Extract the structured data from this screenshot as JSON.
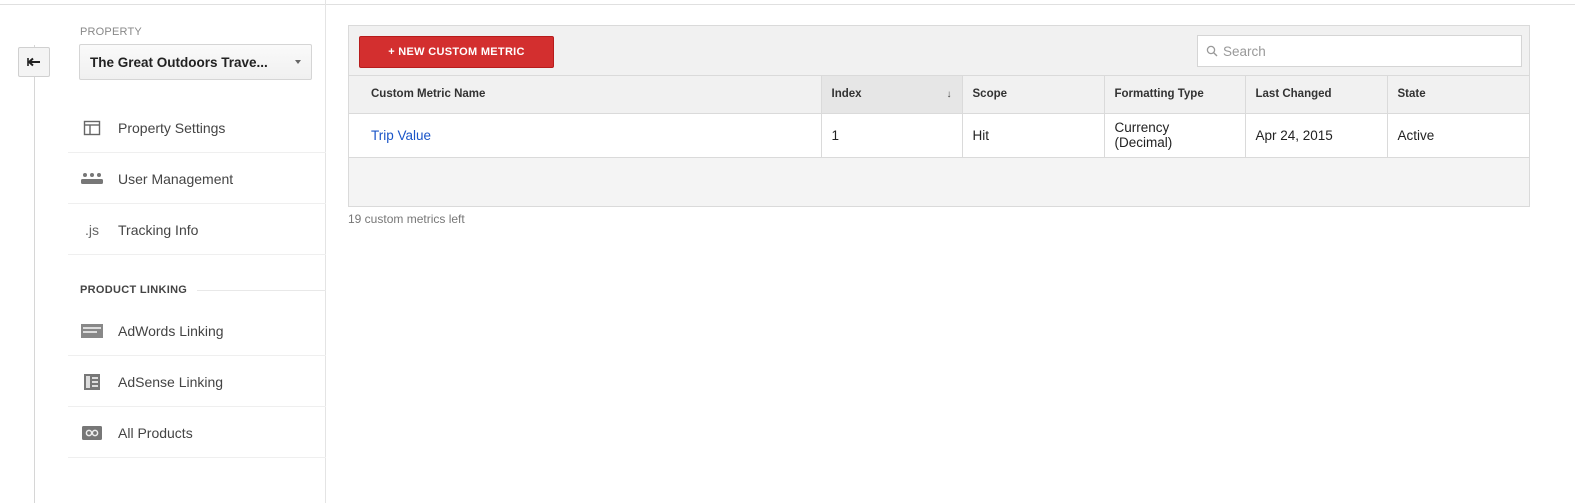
{
  "sidebar": {
    "property_label": "PROPERTY",
    "property_name": "The Great Outdoors Trave...",
    "items": [
      {
        "label": "Property Settings",
        "icon": "property-settings-icon"
      },
      {
        "label": "User Management",
        "icon": "users-icon"
      },
      {
        "label": "Tracking Info",
        "icon": "js-icon",
        "icon_text": ".js"
      }
    ],
    "section_label": "PRODUCT LINKING",
    "linking_items": [
      {
        "label": "AdWords Linking",
        "icon": "adwords-icon"
      },
      {
        "label": "AdSense Linking",
        "icon": "adsense-icon"
      },
      {
        "label": "All Products",
        "icon": "all-products-icon"
      }
    ]
  },
  "toolbar": {
    "new_button": "+ NEW CUSTOM METRIC",
    "search_placeholder": "Search",
    "accent_color": "#d32f2f"
  },
  "table": {
    "columns": [
      "Custom Metric Name",
      "Index",
      "Scope",
      "Formatting Type",
      "Last Changed",
      "State"
    ],
    "sorted_column": "Index",
    "sort_arrow": "↓",
    "rows": [
      {
        "name": "Trip Value",
        "index": "1",
        "scope": "Hit",
        "formatting_line1": "Currency",
        "formatting_line2": "(Decimal)",
        "last_changed": "Apr 24, 2015",
        "state": "Active"
      }
    ]
  },
  "footnote": "19 custom metrics left",
  "link_color": "#1a55c8"
}
